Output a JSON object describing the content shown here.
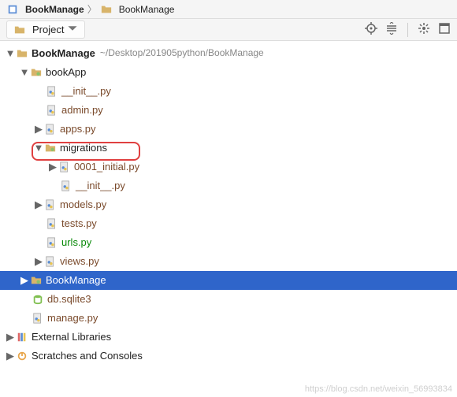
{
  "breadcrumb": {
    "items": [
      {
        "label": "BookManage"
      },
      {
        "label": "BookManage"
      }
    ]
  },
  "toolbar": {
    "project_label": "Project"
  },
  "tree": {
    "root": {
      "name": "BookManage",
      "path": "~/Desktop/201905python/BookManage",
      "bookapp": {
        "name": "bookApp",
        "init": "__init__.py",
        "admin": "admin.py",
        "apps": "apps.py",
        "migrations": {
          "name": "migrations",
          "file1": "0001_initial.py",
          "init": "__init__.py"
        },
        "models": "models.py",
        "tests": "tests.py",
        "urls": "urls.py",
        "views": "views.py"
      },
      "inner_pkg": "BookManage",
      "db": "db.sqlite3",
      "manage": "manage.py"
    },
    "ext_libs": "External Libraries",
    "scratches": "Scratches and Consoles"
  },
  "watermark": "https://blog.csdn.net/weixin_56993834"
}
